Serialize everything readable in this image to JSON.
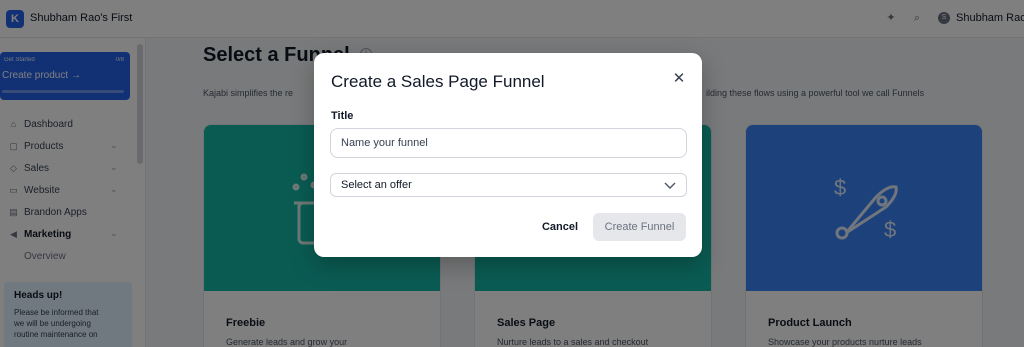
{
  "app": {
    "logo": "K",
    "title": "Shubham Rao's First"
  },
  "header": {
    "icons": [
      "sparkle-icon",
      "search-icon"
    ],
    "user": {
      "initial": "S",
      "name": "Shubham Rao"
    }
  },
  "sidebar": {
    "get_started": {
      "small_label": "Get Started",
      "percent": "0/8",
      "progress": 0.0,
      "label": "Create product",
      "arrow": "→"
    },
    "items": [
      {
        "icon": "home-icon",
        "glyph": "⌂",
        "label": "Dashboard",
        "chevron": false
      },
      {
        "icon": "box-icon",
        "glyph": "▢",
        "label": "Products",
        "chevron": true
      },
      {
        "icon": "tag-icon",
        "glyph": "◇",
        "label": "Sales",
        "chevron": true
      },
      {
        "icon": "monitor-icon",
        "glyph": "▭",
        "label": "Website",
        "chevron": true
      },
      {
        "icon": "document-icon",
        "glyph": "▤",
        "label": "Brandon Apps",
        "chevron": false
      },
      {
        "icon": "megaphone-icon",
        "glyph": "◀",
        "label": "Marketing",
        "chevron": true
      },
      {
        "icon": "",
        "glyph": "",
        "label": "Overview",
        "chevron": false
      }
    ],
    "notice": {
      "title": "Heads up!",
      "body": [
        "Please be informed that",
        "we will be undergoing",
        "routine maintenance on"
      ]
    }
  },
  "main": {
    "title": "Select a Funnel",
    "desc_left": "Kajabi simplifies the re",
    "desc_right": "ilding these flows using a powerful tool we call Funnels",
    "cards": [
      {
        "title": "Freebie",
        "desc": "Generate leads and grow your",
        "color": "#14b8a6"
      },
      {
        "title": "Sales Page",
        "desc": "Nurture leads to a sales and checkout",
        "color": "#14b8a6"
      },
      {
        "title": "Product Launch",
        "desc": "Showcase your products nurture leads",
        "color": "#3b82f6"
      }
    ]
  },
  "modal": {
    "title": "Create a Sales Page Funnel",
    "close_glyph": "✕",
    "title_label": "Title",
    "title_placeholder": "Name your funnel",
    "title_value": "",
    "offer_selected": "Select an offer",
    "cancel_label": "Cancel",
    "create_label": "Create Funnel"
  },
  "colors": {
    "accent": "#2563eb",
    "teal": "#14b8a6",
    "blue_card": "#3b82f6",
    "overlay": "rgba(0,0,0,0.5)"
  }
}
